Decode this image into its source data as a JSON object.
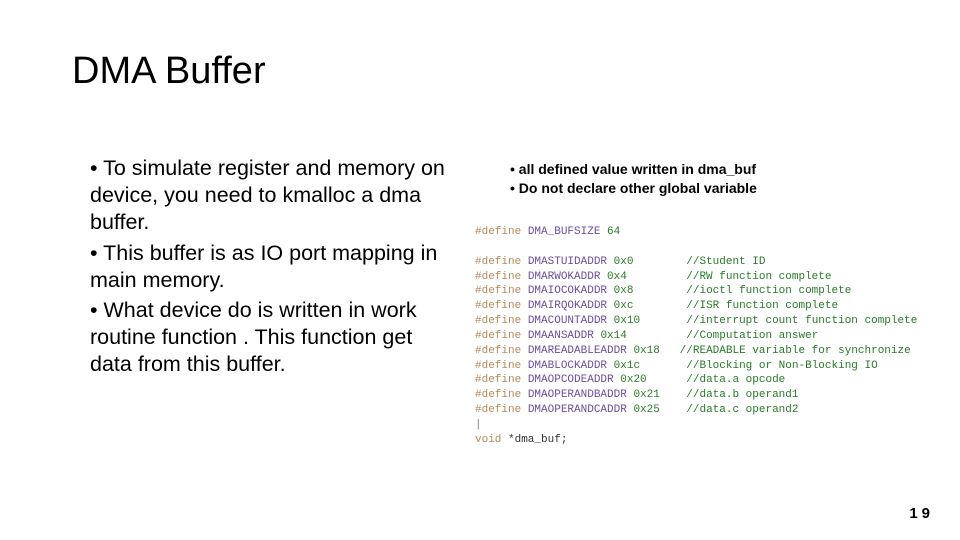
{
  "title": "DMA Buffer",
  "left_bullets": [
    "To simulate register and memory on device, you need to kmalloc a dma buffer.",
    "This buffer is as IO port mapping in main memory.",
    "What device do is written in work routine function . This function get data from this buffer."
  ],
  "right_notes": [
    "all defined value written in dma_buf",
    "Do not declare other global variable"
  ],
  "code": {
    "l0": {
      "kw": "#define",
      "mac": " DMA_BUFSIZE",
      "num": " 64",
      "cmt": ""
    },
    "l1": {
      "kw": "#define",
      "mac": " DMASTUIDADDR",
      "num": " 0x0",
      "cmt": "        //Student ID"
    },
    "l2": {
      "kw": "#define",
      "mac": " DMARWOKADDR",
      "num": " 0x4",
      "cmt": "         //RW function complete"
    },
    "l3": {
      "kw": "#define",
      "mac": " DMAIOCOKADDR",
      "num": " 0x8",
      "cmt": "        //ioctl function complete"
    },
    "l4": {
      "kw": "#define",
      "mac": " DMAIRQOKADDR",
      "num": " 0xc",
      "cmt": "        //ISR function complete"
    },
    "l5": {
      "kw": "#define",
      "mac": " DMACOUNTADDR",
      "num": " 0x10",
      "cmt": "       //interrupt count function complete"
    },
    "l6": {
      "kw": "#define",
      "mac": " DMAANSADDR",
      "num": " 0x14",
      "cmt": "         //Computation answer"
    },
    "l7": {
      "kw": "#define",
      "mac": " DMAREADABLEADDR",
      "num": " 0x18",
      "cmt": "   //READABLE variable for synchronize"
    },
    "l8": {
      "kw": "#define",
      "mac": " DMABLOCKADDR",
      "num": " 0x1c",
      "cmt": "       //Blocking or Non-Blocking IO"
    },
    "l9": {
      "kw": "#define",
      "mac": " DMAOPCODEADDR",
      "num": " 0x20",
      "cmt": "      //data.a opcode"
    },
    "l10": {
      "kw": "#define",
      "mac": " DMAOPERANDBADDR",
      "num": " 0x21",
      "cmt": "    //data.b operand1"
    },
    "l11": {
      "kw": "#define",
      "mac": " DMAOPERANDCADDR",
      "num": " 0x25",
      "cmt": "    //data.c operand2"
    },
    "decl_kw": "void",
    "decl_rest": " *dma_buf;"
  },
  "page_number": "19"
}
